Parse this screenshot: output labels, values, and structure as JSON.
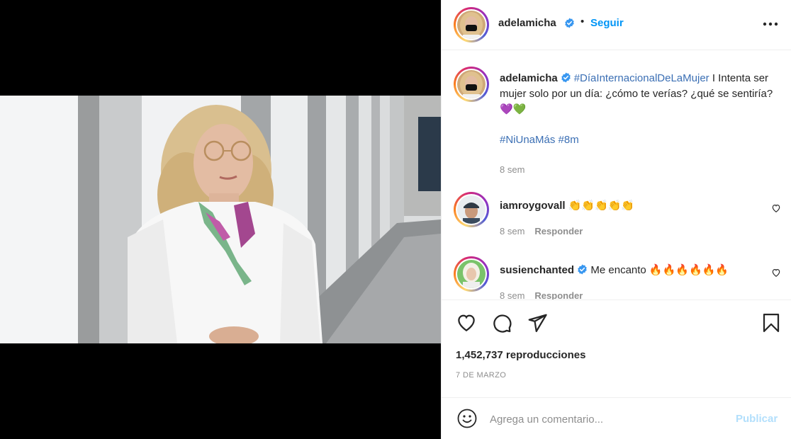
{
  "post": {
    "author": "adelamicha",
    "follow_label": "Seguir",
    "separator": "•",
    "more_icon": "more-horizontal-icon",
    "verified_icon": "verified-badge-icon"
  },
  "caption": {
    "author": "adelamicha",
    "hashtag_main": "#DíaInternacionalDeLaMujer",
    "text": "I Intenta ser mujer solo por un día: ¿cómo te verías? ¿qué se sentiría?",
    "emojis": "💜💚",
    "hashtags": "#NiUnaMás #8m",
    "time": "8 sem"
  },
  "comments": [
    {
      "author": "iamroygovall",
      "text": "👏👏👏👏👏",
      "time": "8 sem",
      "reply_label": "Responder",
      "verified": false
    },
    {
      "author": "susienchanted",
      "text": "Me encanto 🔥🔥🔥🔥🔥🔥",
      "time": "8 sem",
      "reply_label": "Responder",
      "verified": true
    }
  ],
  "actions": {
    "like_icon": "heart-icon",
    "comment_icon": "comment-icon",
    "share_icon": "paper-plane-icon",
    "save_icon": "bookmark-icon"
  },
  "stats": {
    "views": "1,452,737 reproducciones",
    "date": "7 DE MARZO"
  },
  "composer": {
    "emoji_icon": "smiley-icon",
    "placeholder": "Agrega un comentario...",
    "publish_label": "Publicar"
  },
  "colors": {
    "accent": "#0095f6",
    "link": "#3b6fb4",
    "muted": "#8e8e8e",
    "publish_disabled": "#b2dffc"
  }
}
